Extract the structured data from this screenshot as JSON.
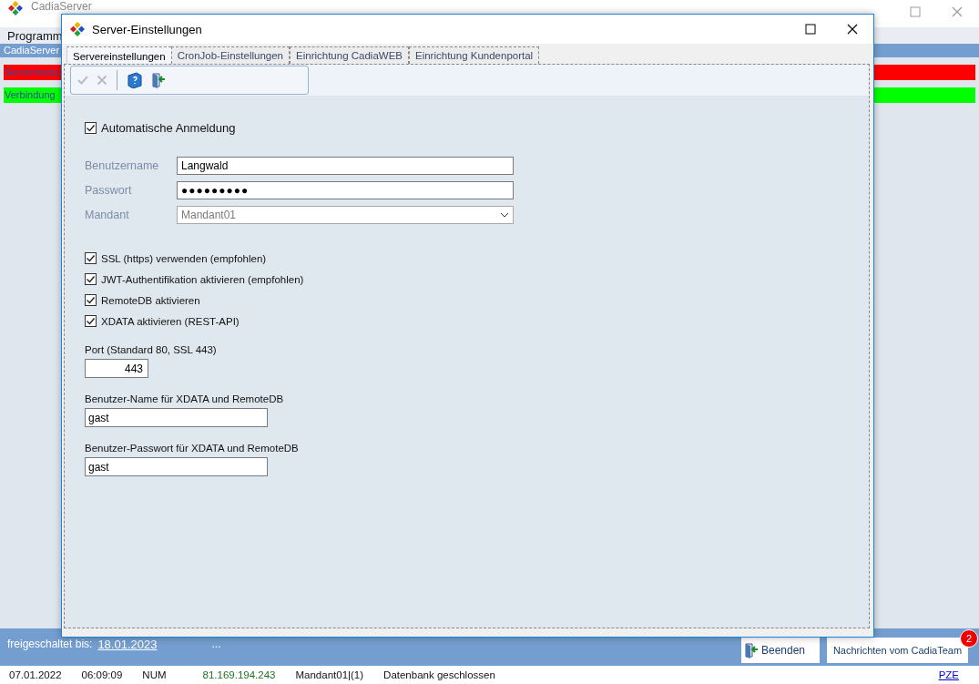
{
  "main_window": {
    "title": "CadiaServer",
    "menu": [
      "Programm"
    ],
    "header": "CadiaServer",
    "status_rows": [
      {
        "text": "Servermodu",
        "color": "#ff0000"
      },
      {
        "text": "Verbindung",
        "color": "#00ff00"
      }
    ],
    "license": {
      "label": "freigeschaltet bis:",
      "date": "18.01.2023",
      "more": "..."
    },
    "buttons": [
      {
        "label": "Beenden",
        "kind": "exit"
      },
      {
        "label": "Nachrichten vom CadiaTeam",
        "kind": "messages",
        "badge": "2"
      }
    ],
    "status_bar": [
      {
        "text": "07.01.2022",
        "kind": "plain"
      },
      {
        "text": "06:09:09",
        "kind": "plain"
      },
      {
        "text": "NUM",
        "kind": "plain"
      },
      {
        "text": "81.169.194.243",
        "kind": "address"
      },
      {
        "text": "Mandant01|(1)",
        "kind": "plain"
      },
      {
        "text": "Datenbank geschlossen",
        "kind": "plain"
      }
    ],
    "status_link": "PZE"
  },
  "dialog": {
    "title": "Server-Einstellungen",
    "tabs": [
      {
        "label": "Servereinstellungen",
        "selected": true
      },
      {
        "label": "CronJob-Einstellungen",
        "selected": false
      },
      {
        "label": "Einrichtung CadiaWEB",
        "selected": false
      },
      {
        "label": "Einrichtung Kundenportal",
        "selected": false
      }
    ],
    "toolbar": [
      {
        "kind": "confirm",
        "disabled": true
      },
      {
        "kind": "cancel",
        "disabled": true
      },
      {
        "kind": "help",
        "disabled": false
      },
      {
        "kind": "exit",
        "disabled": false
      }
    ],
    "auto_login": {
      "label": "Automatische Anmeldung",
      "checked": true
    },
    "login_fields": [
      {
        "label": "Benutzername",
        "value": "Langwald",
        "kind": "text",
        "disabled": false
      },
      {
        "label": "Passwort",
        "value": "●●●●●●●●●",
        "kind": "password",
        "disabled": false
      },
      {
        "label": "Mandant",
        "value": "Mandant01",
        "kind": "dropdown",
        "disabled": true
      }
    ],
    "options": [
      {
        "label": "SSL (https) verwenden (empfohlen)",
        "checked": true
      },
      {
        "label": "JWT-Authentifikation aktivieren (empfohlen)",
        "checked": true
      },
      {
        "label": "RemoteDB aktivieren",
        "checked": true
      },
      {
        "label": "XDATA aktivieren (REST-API)",
        "checked": true
      }
    ],
    "settings": [
      {
        "label": "Port (Standard 80, SSL 443)",
        "value": "443",
        "kind": "number"
      },
      {
        "label": "Benutzer-Name für XDATA und RemoteDB",
        "value": "gast",
        "kind": "text"
      },
      {
        "label": "Benutzer-Passwort für XDATA und RemoteDB",
        "value": "gast",
        "kind": "text"
      }
    ]
  }
}
